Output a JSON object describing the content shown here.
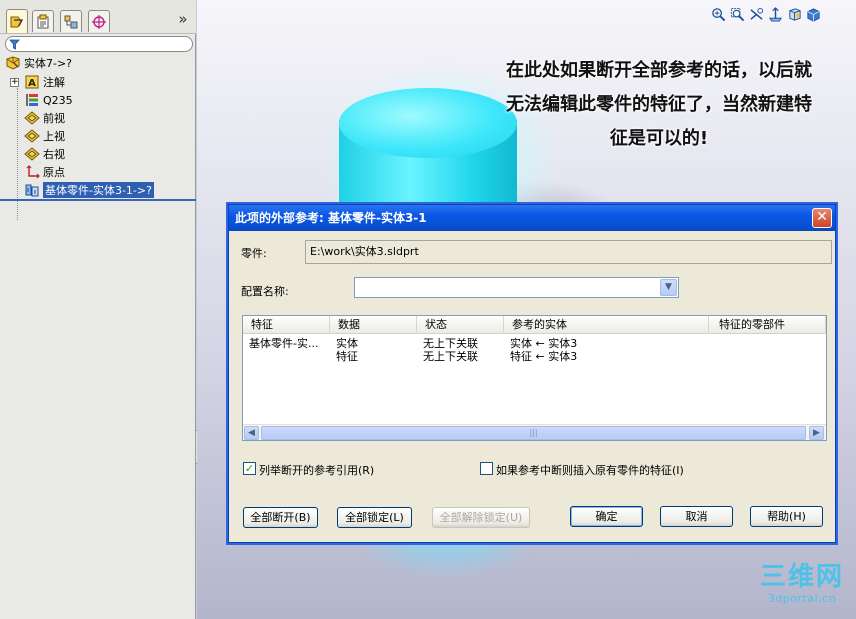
{
  "feature_tree": {
    "root_label": "实体7->?",
    "items": [
      {
        "label": "注解"
      },
      {
        "label": "Q235"
      },
      {
        "label": "前视"
      },
      {
        "label": "上视"
      },
      {
        "label": "右视"
      },
      {
        "label": "原点"
      },
      {
        "label": "基体零件-实体3-1->?"
      }
    ],
    "collapse_glyph": "»"
  },
  "annotation": {
    "lines": [
      "在此处如果断开全部参考的话，以后就",
      "无法编辑此零件的特征了，当然新建特",
      "征是可以的!"
    ]
  },
  "dialog": {
    "title": "此项的外部参考:  基体零件-实体3-1",
    "part_label": "零件:",
    "part_value": "E:\\work\\实体3.sldprt",
    "config_label": "配置名称:",
    "config_value": "",
    "columns": [
      "特征",
      "数据",
      "状态",
      "参考的实体",
      "特征的零部件"
    ],
    "rows": [
      {
        "feature": "基体零件-实...",
        "data": "实体",
        "status": "无上下关联",
        "ref_entity": "实体 ← 实体3",
        "component": ""
      },
      {
        "feature": "",
        "data": "特征",
        "status": "无上下关联",
        "ref_entity": "特征 ← 实体3",
        "component": ""
      }
    ],
    "scroll_thumb_glyph": "|||",
    "list_broken_label": "列举断开的参考引用(R)",
    "list_broken_checked": true,
    "insert_label": "如果参考中断则插入原有零件的特征(I)",
    "insert_checked": false,
    "buttons": {
      "break_all": "全部断开(B)",
      "lock_all": "全部锁定(L)",
      "unlock_all": "全部解除锁定(U)",
      "ok": "确定",
      "cancel": "取消",
      "help": "帮助(H)"
    },
    "close_glyph": "✕"
  },
  "watermark": {
    "main": "三维网",
    "sub": "3dportal.cn"
  },
  "colors": {
    "accent": "#0a57e3",
    "selection": "#2e5fb3",
    "model": "#3fe7fa"
  }
}
